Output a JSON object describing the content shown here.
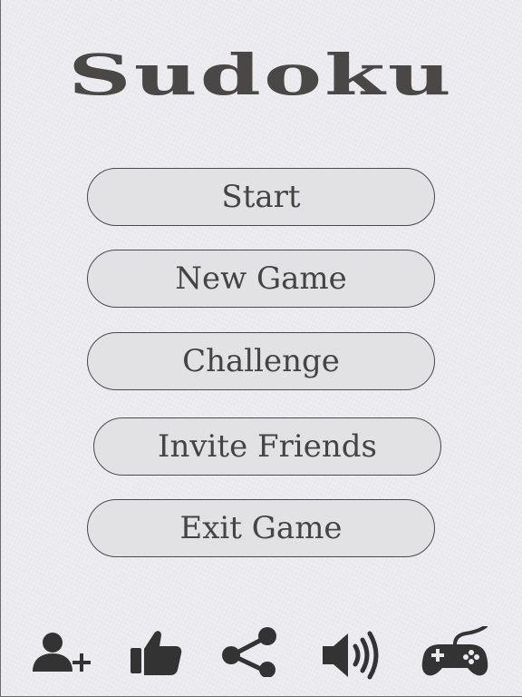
{
  "app": {
    "title": "Sudoku"
  },
  "menu": {
    "start_label": "Start",
    "new_game_label": "New Game",
    "challenge_label": "Challenge",
    "invite_friends_label": "Invite Friends",
    "exit_game_label": "Exit Game"
  },
  "toolbar": {
    "icons": [
      "add-friend-icon",
      "thumbs-up-icon",
      "share-icon",
      "sound-icon",
      "gamepad-icon"
    ]
  },
  "colors": {
    "background": "#ebeaee",
    "button_fill": "#e2e1e3",
    "text": "#444444",
    "icon": "#333333"
  }
}
